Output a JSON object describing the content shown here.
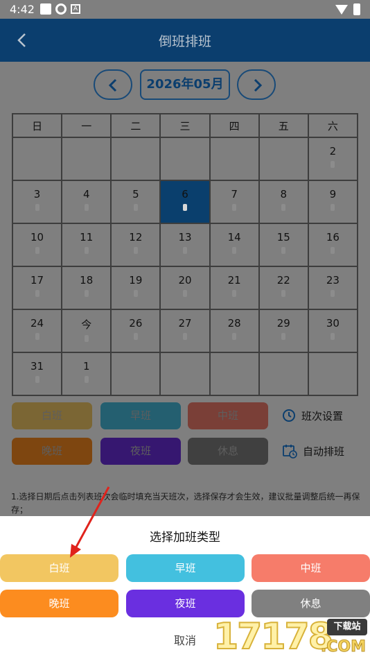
{
  "status_bar": {
    "time": "4:42",
    "notif_icon_text": "A"
  },
  "app_bar": {
    "title": "倒班排班"
  },
  "calendar": {
    "month_label": "2026年05月",
    "weekdays": [
      "日",
      "一",
      "二",
      "三",
      "四",
      "五",
      "六"
    ],
    "weeks": [
      [
        "",
        "",
        "",
        "",
        "",
        "",
        "2"
      ],
      [
        "3",
        "4",
        "5",
        "6",
        "7",
        "8",
        "9"
      ],
      [
        "10",
        "11",
        "12",
        "13",
        "14",
        "15",
        "16"
      ],
      [
        "17",
        "18",
        "19",
        "20",
        "21",
        "22",
        "23"
      ],
      [
        "24",
        "今",
        "26",
        "27",
        "28",
        "29",
        "30"
      ],
      [
        "31",
        "1",
        "",
        "",
        "",
        "",
        ""
      ]
    ],
    "selected_day": "6"
  },
  "legend": {
    "shift_day": "白班",
    "shift_early": "早班",
    "shift_mid": "中班",
    "shift_late": "晚班",
    "shift_night": "夜班",
    "shift_rest": "休息",
    "settings_link": "班次设置",
    "auto_link": "自动排班"
  },
  "note": "1.选择日期后点击列表班次会临时填充当天班次，选择保存才会生效，建议批量调整后统一再保存；",
  "sheet": {
    "title": "选择加班类型",
    "options": [
      "白班",
      "早班",
      "中班",
      "晚班",
      "夜班",
      "休息"
    ],
    "cancel": "取消"
  },
  "colors": {
    "day": "#f2c661",
    "early": "#43c0df",
    "mid": "#f67c6a",
    "late": "#fc8c1f",
    "night": "#6a2fe0",
    "rest": "#808080",
    "primary": "#0b3e6e",
    "arrow": "#e0231c"
  },
  "watermark": {
    "number": "17178",
    "tag": "下载站",
    "suffix": ".COM"
  }
}
